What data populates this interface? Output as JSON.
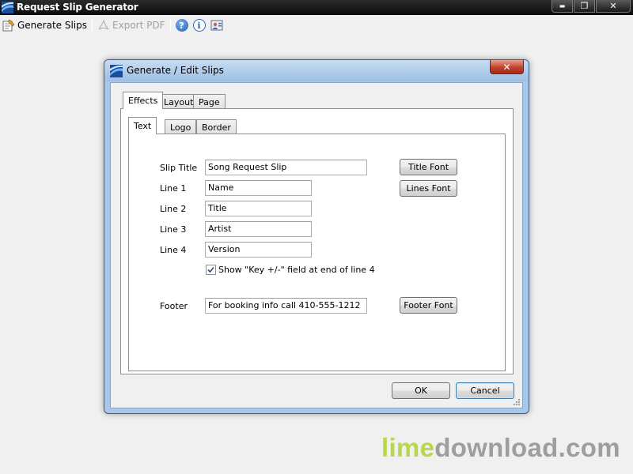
{
  "window": {
    "title": "Request Slip Generator",
    "minimize_glyph": "▬",
    "restore_glyph": "❐",
    "close_glyph": "✕"
  },
  "toolbar": {
    "generate_label": "Generate Slips",
    "export_label": "Export PDF",
    "help_icon": "?",
    "info_icon": "i"
  },
  "dialog": {
    "title": "Generate / Edit Slips",
    "close_glyph": "✕",
    "outer_tabs": [
      "Effects",
      "Layout",
      "Page"
    ],
    "inner_tabs": [
      "Text",
      "Logo",
      "Border"
    ],
    "fields": {
      "slip_title_label": "Slip Title",
      "slip_title_value": "Song Request Slip",
      "line1_label": "Line 1",
      "line1_value": "Name",
      "line2_label": "Line 2",
      "line2_value": "Title",
      "line3_label": "Line 3",
      "line3_value": "Artist",
      "line4_label": "Line 4",
      "line4_value": "Version",
      "key_checkbox_label": "Show \"Key +/-\" field at end of line 4",
      "key_checkbox_checked": true,
      "footer_label": "Footer",
      "footer_value": "For booking info call 410-555-1212"
    },
    "buttons": {
      "title_font": "Title Font",
      "lines_font": "Lines Font",
      "footer_font": "Footer Font",
      "ok": "OK",
      "cancel": "Cancel"
    }
  },
  "watermark": {
    "lime": "lime",
    "rest": "download.com"
  },
  "colors": {
    "titlebar": "#0a0a0a",
    "dialog_frame": "#a9c7e8",
    "close_button": "#c0442c",
    "watermark_green": "#b8d84a"
  }
}
